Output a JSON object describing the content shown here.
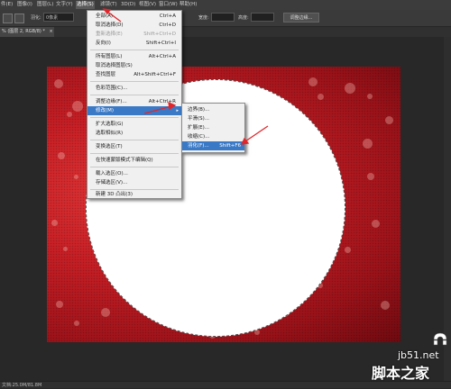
{
  "menubar": {
    "items": [
      "件(E)",
      "图像(I)",
      "图层(L)",
      "文字(Y)",
      "选择(S)",
      "滤镜(T)",
      "3D(D)",
      "视图(V)",
      "窗口(W)",
      "帮助(H)"
    ],
    "active_index": 4
  },
  "options": {
    "feather_label": "羽化:",
    "feather_value": "0像素",
    "width_label": "宽度:",
    "height_label": "高度:",
    "refine_button": "调整边缘..."
  },
  "tab": {
    "title": "% (图层 2, RGB/8) *",
    "close": "×"
  },
  "status": {
    "text": "文档:25.0M/81.8M"
  },
  "select_menu": {
    "items": [
      {
        "label": "全部(A)",
        "shortcut": "Ctrl+A"
      },
      {
        "label": "取消选择(D)",
        "shortcut": "Ctrl+D"
      },
      {
        "label": "重新选择(E)",
        "shortcut": "Shift+Ctrl+D",
        "disabled": true
      },
      {
        "label": "反向(I)",
        "shortcut": "Shift+Ctrl+I"
      },
      {
        "label": "所有图层(L)",
        "shortcut": "Alt+Ctrl+A"
      },
      {
        "label": "取消选择图层(S)",
        "shortcut": ""
      },
      {
        "label": "查找图层",
        "shortcut": "Alt+Shift+Ctrl+F"
      },
      {
        "label": "色彩范围(C)...",
        "shortcut": ""
      },
      {
        "label": "调整边缘(F)...",
        "shortcut": "Alt+Ctrl+R"
      },
      {
        "label": "修改(M)",
        "shortcut": "",
        "submenu": true,
        "highlighted": true
      },
      {
        "label": "扩大选取(G)",
        "shortcut": ""
      },
      {
        "label": "选取相似(R)",
        "shortcut": ""
      },
      {
        "label": "变换选区(T)",
        "shortcut": ""
      },
      {
        "label": "在快速蒙版模式下编辑(Q)",
        "shortcut": ""
      },
      {
        "label": "载入选区(O)...",
        "shortcut": ""
      },
      {
        "label": "存储选区(V)...",
        "shortcut": ""
      },
      {
        "label": "新建 3D 凸出(3)",
        "shortcut": ""
      }
    ]
  },
  "modify_submenu": {
    "items": [
      {
        "label": "边界(B)...",
        "shortcut": ""
      },
      {
        "label": "平滑(S)...",
        "shortcut": ""
      },
      {
        "label": "扩展(E)...",
        "shortcut": ""
      },
      {
        "label": "收缩(C)...",
        "shortcut": ""
      },
      {
        "label": "羽化(F)...",
        "shortcut": "Shift+F6",
        "highlighted": true
      }
    ]
  },
  "watermark": {
    "url": "jb51.net",
    "text": "脚本之家"
  },
  "colors": {
    "accent": "#3a79c6",
    "annotation": "#e0262b",
    "canvas_red": "#c61f25"
  }
}
